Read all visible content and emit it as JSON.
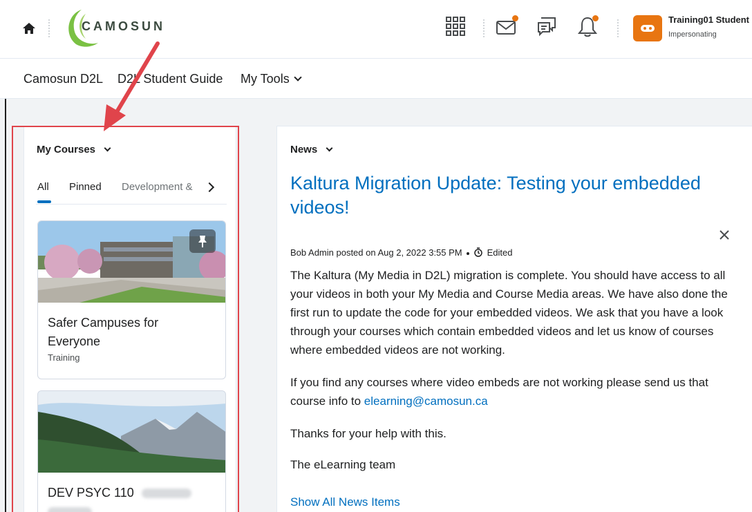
{
  "header": {
    "logo_text": "CAMOSUN",
    "user_name": "Training01 Student",
    "user_role": "Impersonating",
    "colors": {
      "accent": "#e87511",
      "link": "#006fbf",
      "highlight": "#e0444b"
    }
  },
  "nav": {
    "items": [
      {
        "label": "Camosun D2L"
      },
      {
        "label": "D2L Student Guide"
      },
      {
        "label": "My Tools"
      }
    ]
  },
  "my_courses": {
    "title": "My Courses",
    "tabs": [
      {
        "label": "All",
        "selected": true
      },
      {
        "label": "Pinned"
      },
      {
        "label": "Development &"
      }
    ],
    "cards": [
      {
        "name": "Safer Campuses for Everyone",
        "subtitle": "Training",
        "pinned": true
      },
      {
        "name": "DEV PSYC 110"
      }
    ]
  },
  "news": {
    "title": "News",
    "headline": "Kaltura Migration Update: Testing your embedded videos!",
    "meta": "Bob Admin posted on Aug 2, 2022 3:55 PM",
    "edited_label": "Edited",
    "paragraphs": [
      "The Kaltura (My Media in D2L) migration is complete. You should have access to all your videos in both your My Media and Course Media areas. We have also done the first run to update the code for your embedded videos. We ask that you have a look through your courses which contain embedded videos and let us know of courses where embedded videos are not working.",
      "If you find any courses where video embeds are not working please send us that course info to",
      "Thanks for your help with this.",
      "The eLearning team"
    ],
    "email_link": "elearning@camosun.ca",
    "show_all": "Show All News Items"
  }
}
